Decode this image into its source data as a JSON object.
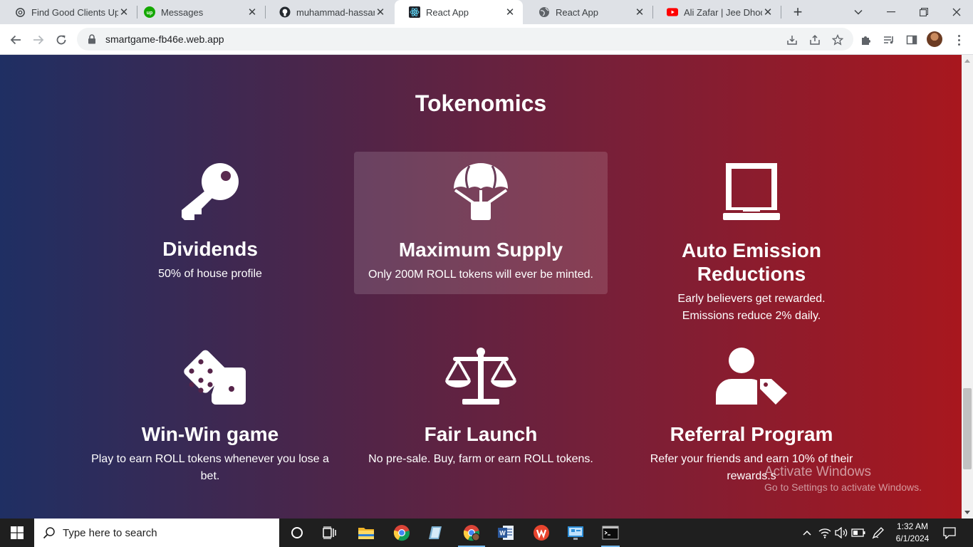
{
  "browser": {
    "tabs": [
      {
        "label": "Find Good Clients Upwork",
        "icon": "openai-icon",
        "active": false
      },
      {
        "label": "Messages",
        "icon": "upwork-icon",
        "active": false
      },
      {
        "label": "muhammad-hassan-m",
        "icon": "github-icon",
        "active": false
      },
      {
        "label": "React App",
        "icon": "react-icon",
        "active": true
      },
      {
        "label": "React App",
        "icon": "globe-icon",
        "active": false
      },
      {
        "label": "Ali Zafar | Jee Dhoond",
        "icon": "youtube-icon",
        "active": false
      }
    ],
    "url": "smartgame-fb46e.web.app"
  },
  "page": {
    "title": "Tokenomics",
    "cards": [
      {
        "title": "Dividends",
        "desc": "50% of house profile",
        "icon": "key-icon"
      },
      {
        "title": "Maximum Supply",
        "desc": "Only 200M ROLL tokens will ever be minted.",
        "icon": "parachute-box-icon"
      },
      {
        "title": "Auto Emission Reductions",
        "desc": "Early believers get rewarded. Emissions reduce 2% daily.",
        "icon": "laptop-icon"
      },
      {
        "title": "Win-Win game",
        "desc": "Play to earn ROLL tokens whenever you lose a bet.",
        "icon": "dice-icon"
      },
      {
        "title": "Fair Launch",
        "desc": "No pre-sale. Buy, farm or earn ROLL tokens.",
        "icon": "scale-balanced-icon"
      },
      {
        "title": "Referral Program",
        "desc": "Refer your friends and earn 10% of their rewards.s",
        "icon": "user-tag-icon"
      }
    ]
  },
  "watermark": {
    "line1": "Activate Windows",
    "line2": "Go to Settings to activate Windows."
  },
  "taskbar": {
    "search_placeholder": "Type here to search",
    "time": "1:32 AM",
    "date": "6/1/2024"
  },
  "colors": {
    "gradient_left": "#1f2f63",
    "gradient_right": "#a8171e",
    "accent": "#76b9ed"
  }
}
